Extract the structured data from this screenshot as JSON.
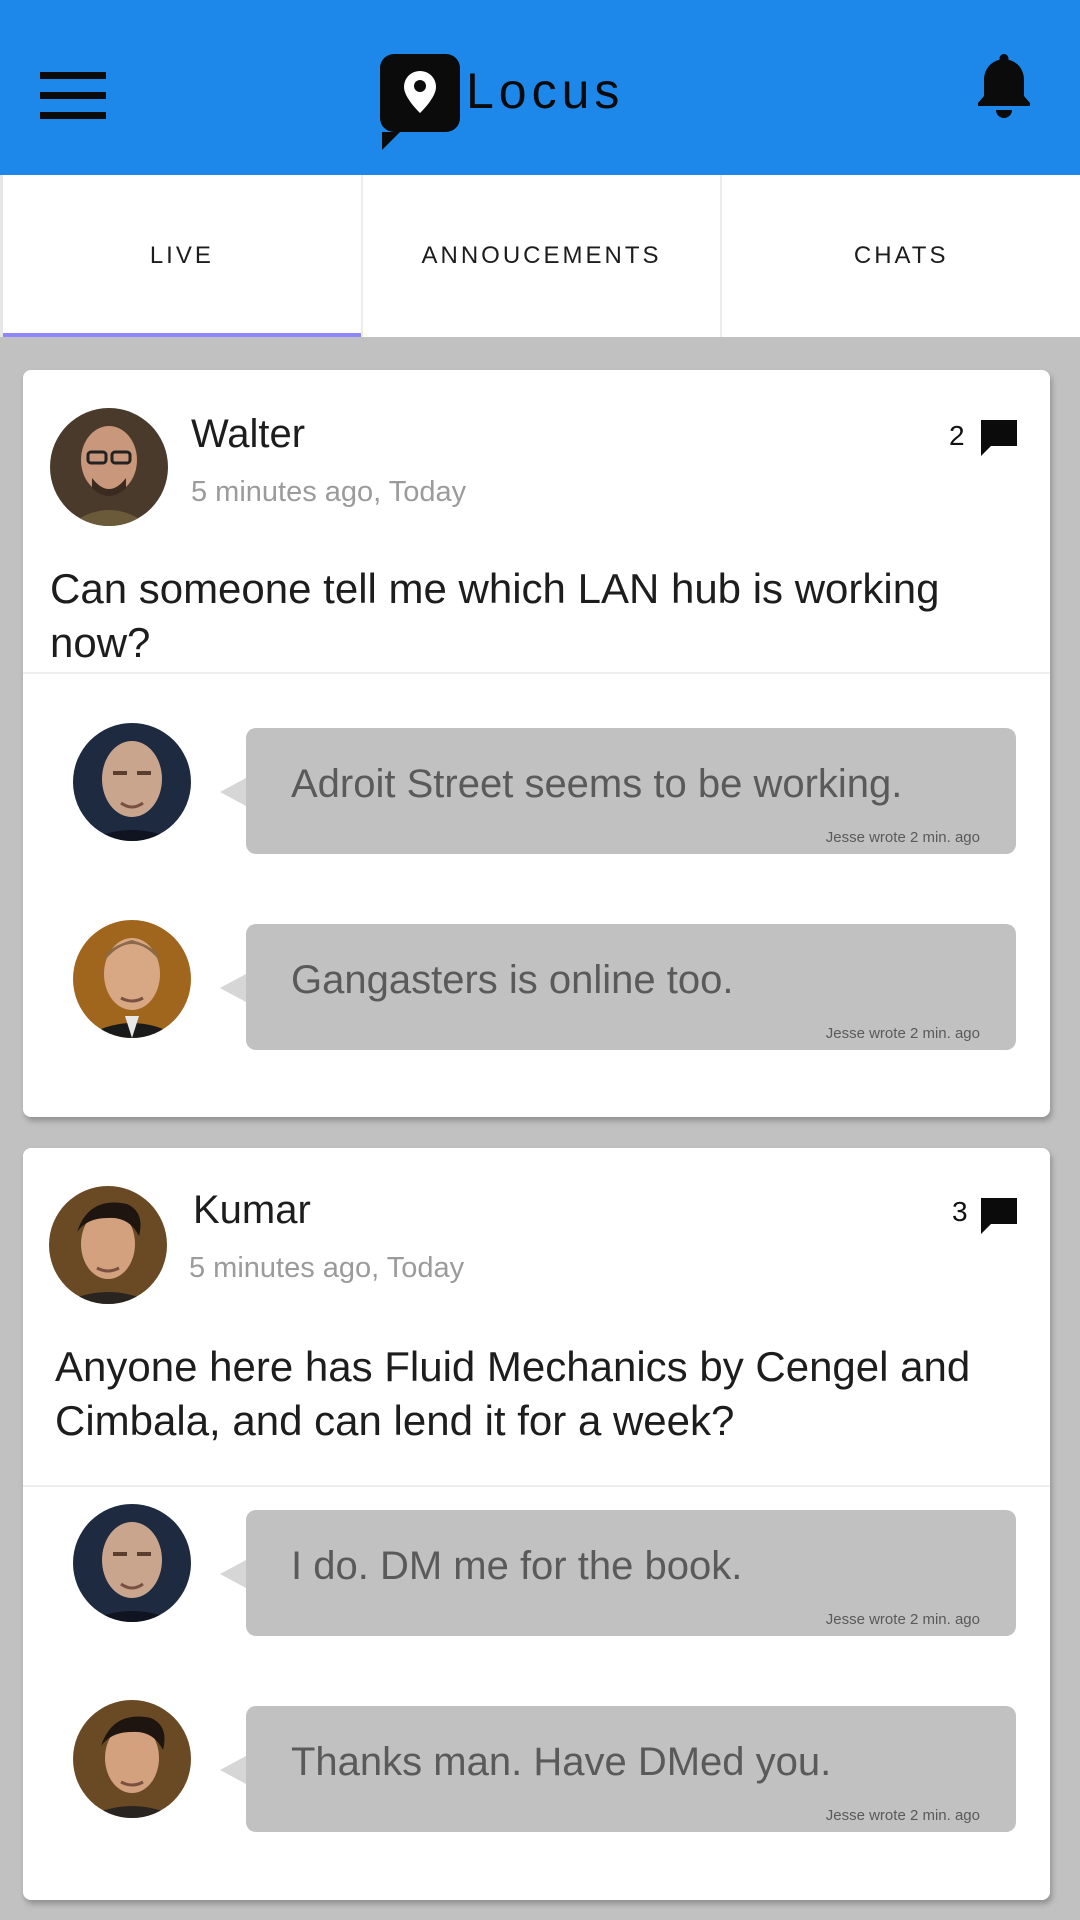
{
  "app": {
    "brand": "Locus"
  },
  "icons": {
    "menu": "hamburger-menu-icon",
    "logo": "map-pin-icon",
    "notifications": "bell-icon",
    "comments": "speech-bubble-icon"
  },
  "colors": {
    "app_bar": "#1e88ea",
    "active_tab_indicator": "#8f87ff",
    "background": "#c1c1c1",
    "bubble": "#c1c1c1"
  },
  "tabs": [
    {
      "label": "LIVE",
      "active": true
    },
    {
      "label": "ANNOUCEMENTS",
      "active": false
    },
    {
      "label": "CHATS",
      "active": false
    }
  ],
  "posts": [
    {
      "author": "Walter",
      "time": "5 minutes ago, Today",
      "comment_count": "2",
      "text": "Can someone tell me which LAN hub is working now?",
      "replies": [
        {
          "text": "Adroit Street seems to be working.",
          "meta": "Jesse wrote 2 min. ago"
        },
        {
          "text": "Gangasters is online too.",
          "meta": "Jesse wrote 2 min. ago"
        }
      ]
    },
    {
      "author": "Kumar",
      "time": "5 minutes ago, Today",
      "comment_count": "3",
      "text": "Anyone here has Fluid Mechanics by Cengel and Cimbala, and can lend it for a week?",
      "replies": [
        {
          "text": "I do. DM me for the book.",
          "meta": "Jesse wrote 2 min. ago"
        },
        {
          "text": "Thanks man. Have DMed you.",
          "meta": "Jesse wrote 2 min. ago"
        }
      ]
    }
  ]
}
